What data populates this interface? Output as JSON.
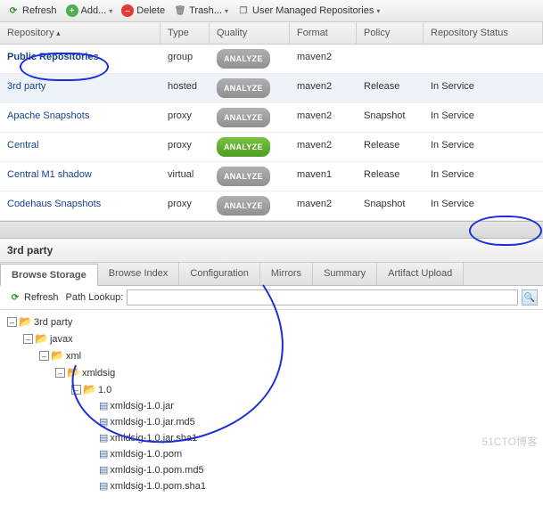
{
  "toolbar": {
    "refresh": "Refresh",
    "add": "Add...",
    "delete": "Delete",
    "trash": "Trash...",
    "userManaged": "User Managed Repositories"
  },
  "columns": {
    "repository": "Repository",
    "type": "Type",
    "quality": "Quality",
    "format": "Format",
    "policy": "Policy",
    "status": "Repository Status"
  },
  "rows": [
    {
      "name": "Public Repositories",
      "bold": true,
      "type": "group",
      "qualGreen": false,
      "format": "maven2",
      "policy": "",
      "status": ""
    },
    {
      "name": "3rd party",
      "type": "hosted",
      "qualGreen": false,
      "format": "maven2",
      "policy": "Release",
      "status": "In Service",
      "selected": true
    },
    {
      "name": "Apache Snapshots",
      "type": "proxy",
      "qualGreen": false,
      "format": "maven2",
      "policy": "Snapshot",
      "status": "In Service"
    },
    {
      "name": "Central",
      "type": "proxy",
      "qualGreen": true,
      "format": "maven2",
      "policy": "Release",
      "status": "In Service"
    },
    {
      "name": "Central M1 shadow",
      "type": "virtual",
      "qualGreen": false,
      "format": "maven1",
      "policy": "Release",
      "status": "In Service"
    },
    {
      "name": "Codehaus Snapshots",
      "type": "proxy",
      "qualGreen": false,
      "format": "maven2",
      "policy": "Snapshot",
      "status": "In Service"
    }
  ],
  "analyzeLabel": "ANALYZE",
  "detail": {
    "title": "3rd party"
  },
  "tabs": [
    {
      "label": "Browse Storage",
      "active": true
    },
    {
      "label": "Browse Index"
    },
    {
      "label": "Configuration"
    },
    {
      "label": "Mirrors"
    },
    {
      "label": "Summary"
    },
    {
      "label": "Artifact Upload"
    }
  ],
  "pathbar": {
    "refresh": "Refresh",
    "label": "Path Lookup:",
    "value": ""
  },
  "tree": {
    "root": "3rd party",
    "l1": "javax",
    "l2": "xml",
    "l3": "xmldsig",
    "l4": "1.0",
    "files": [
      "xmldsig-1.0.jar",
      "xmldsig-1.0.jar.md5",
      "xmldsig-1.0.jar.sha1",
      "xmldsig-1.0.pom",
      "xmldsig-1.0.pom.md5",
      "xmldsig-1.0.pom.sha1"
    ]
  },
  "watermark": "51CTO博客"
}
